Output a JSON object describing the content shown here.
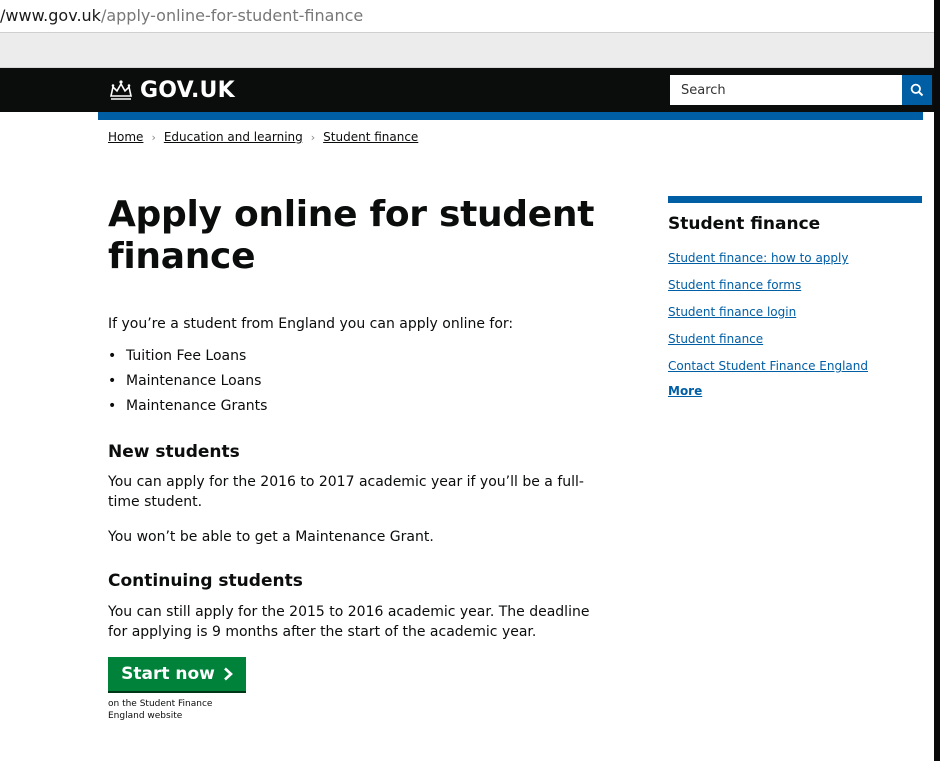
{
  "browser": {
    "url_host": "/www.gov.uk",
    "url_path": "/apply-online-for-student-finance"
  },
  "header": {
    "logo_text": "GOV.UK",
    "search_placeholder": "Search",
    "search_icon": "search-icon"
  },
  "breadcrumb": [
    "Home",
    "Education and learning",
    "Student finance"
  ],
  "main": {
    "title": "Apply online for student finance",
    "intro": "If you’re a student from England you can apply online for:",
    "bullets": [
      "Tuition Fee Loans",
      "Maintenance Loans",
      "Maintenance Grants"
    ],
    "new_students": {
      "heading": "New students",
      "para1": "You can apply for the 2016 to 2017 academic year if you’ll be a full-time student.",
      "para2": "You won’t be able to get a Maintenance Grant."
    },
    "continuing_students": {
      "heading": "Continuing students",
      "para1": "You can still apply for the 2015 to 2016 academic year. The deadline for applying is 9 months after the start of the academic year."
    },
    "start_button": "Start now",
    "start_note": "on the Student Finance England website"
  },
  "sidebar": {
    "title": "Student finance",
    "links": [
      "Student finance: how to apply",
      "Student finance forms",
      "Student finance login",
      "Student finance",
      "Contact Student Finance England"
    ],
    "more": "More"
  },
  "colors": {
    "header_bg": "#0b0c0c",
    "brand_blue": "#005ea5",
    "button_green": "#00823b",
    "text": "#0b0c0c"
  }
}
